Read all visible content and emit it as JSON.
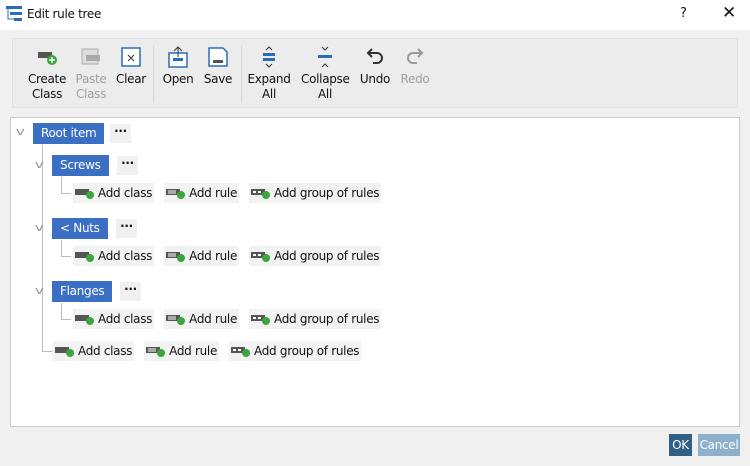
{
  "window": {
    "title": "Edit rule tree",
    "help": "?",
    "close": "✕"
  },
  "toolbar": [
    {
      "line1": "Create",
      "line2": "Class",
      "icon": "create-class-icon",
      "enabled": true
    },
    {
      "line1": "Paste",
      "line2": "Class",
      "icon": "paste-class-icon",
      "enabled": false
    },
    {
      "line1": "Clear",
      "line2": "",
      "icon": "clear-icon",
      "enabled": true
    },
    {
      "line1": "Open",
      "line2": "",
      "icon": "open-icon",
      "enabled": true
    },
    {
      "line1": "Save",
      "line2": "",
      "icon": "save-icon",
      "enabled": true
    },
    {
      "line1": "Expand",
      "line2": "All",
      "icon": "expand-all-icon",
      "enabled": true
    },
    {
      "line1": "Collapse",
      "line2": "All",
      "icon": "collapse-all-icon",
      "enabled": true
    },
    {
      "line1": "Undo",
      "line2": "",
      "icon": "undo-icon",
      "enabled": true
    },
    {
      "line1": "Redo",
      "line2": "",
      "icon": "redo-icon",
      "enabled": false
    }
  ],
  "tree": {
    "root": "Root item",
    "more": "···",
    "children": [
      "Screws",
      "< Nuts",
      "Flanges"
    ],
    "actions": {
      "add_class": "Add class",
      "add_rule": "Add rule",
      "add_group": "Add group of rules"
    }
  },
  "footer": {
    "ok": "OK",
    "cancel": "Cancel"
  },
  "colors": {
    "accent": "#3a6fc4",
    "ok": "#2f5f86",
    "cancel": "#8fb0cc"
  }
}
